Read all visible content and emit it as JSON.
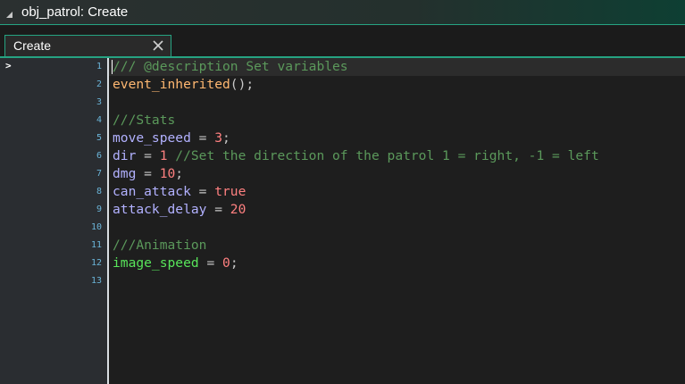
{
  "window": {
    "title": "obj_patrol: Create"
  },
  "tab": {
    "label": "Create"
  },
  "line_numbers": [
    "1",
    "2",
    "3",
    "4",
    "5",
    "6",
    "7",
    "8",
    "9",
    "10",
    "11",
    "12",
    "13"
  ],
  "code": {
    "l1": "/// @description Set variables",
    "l2": {
      "fn": "event_inherited",
      "rest": "();"
    },
    "l4": "///Stats",
    "l5": {
      "name": "move_speed",
      "eq": " = ",
      "val": "3",
      "end": ";"
    },
    "l6": {
      "name": "dir",
      "eq": " = ",
      "val": "1",
      "comment": " //Set the direction of the patrol 1 = right, -1 = left"
    },
    "l7": {
      "name": "dmg",
      "eq": " = ",
      "val": "10",
      "end": ";"
    },
    "l8": {
      "name": "can_attack",
      "eq": " = ",
      "val": "true"
    },
    "l9": {
      "name": "attack_delay",
      "eq": " = ",
      "val": "20"
    },
    "l11": "///Animation",
    "l12": {
      "name": "image_speed",
      "eq": " = ",
      "val": "0",
      "end": ";"
    }
  },
  "colors": {
    "accent": "#26a382",
    "comment": "#5b995b",
    "function": "#ffb871",
    "instance_var": "#b2b1ff",
    "number": "#ff8080",
    "builtin_var": "#58e55a",
    "line_number": "#6ab4d8"
  }
}
